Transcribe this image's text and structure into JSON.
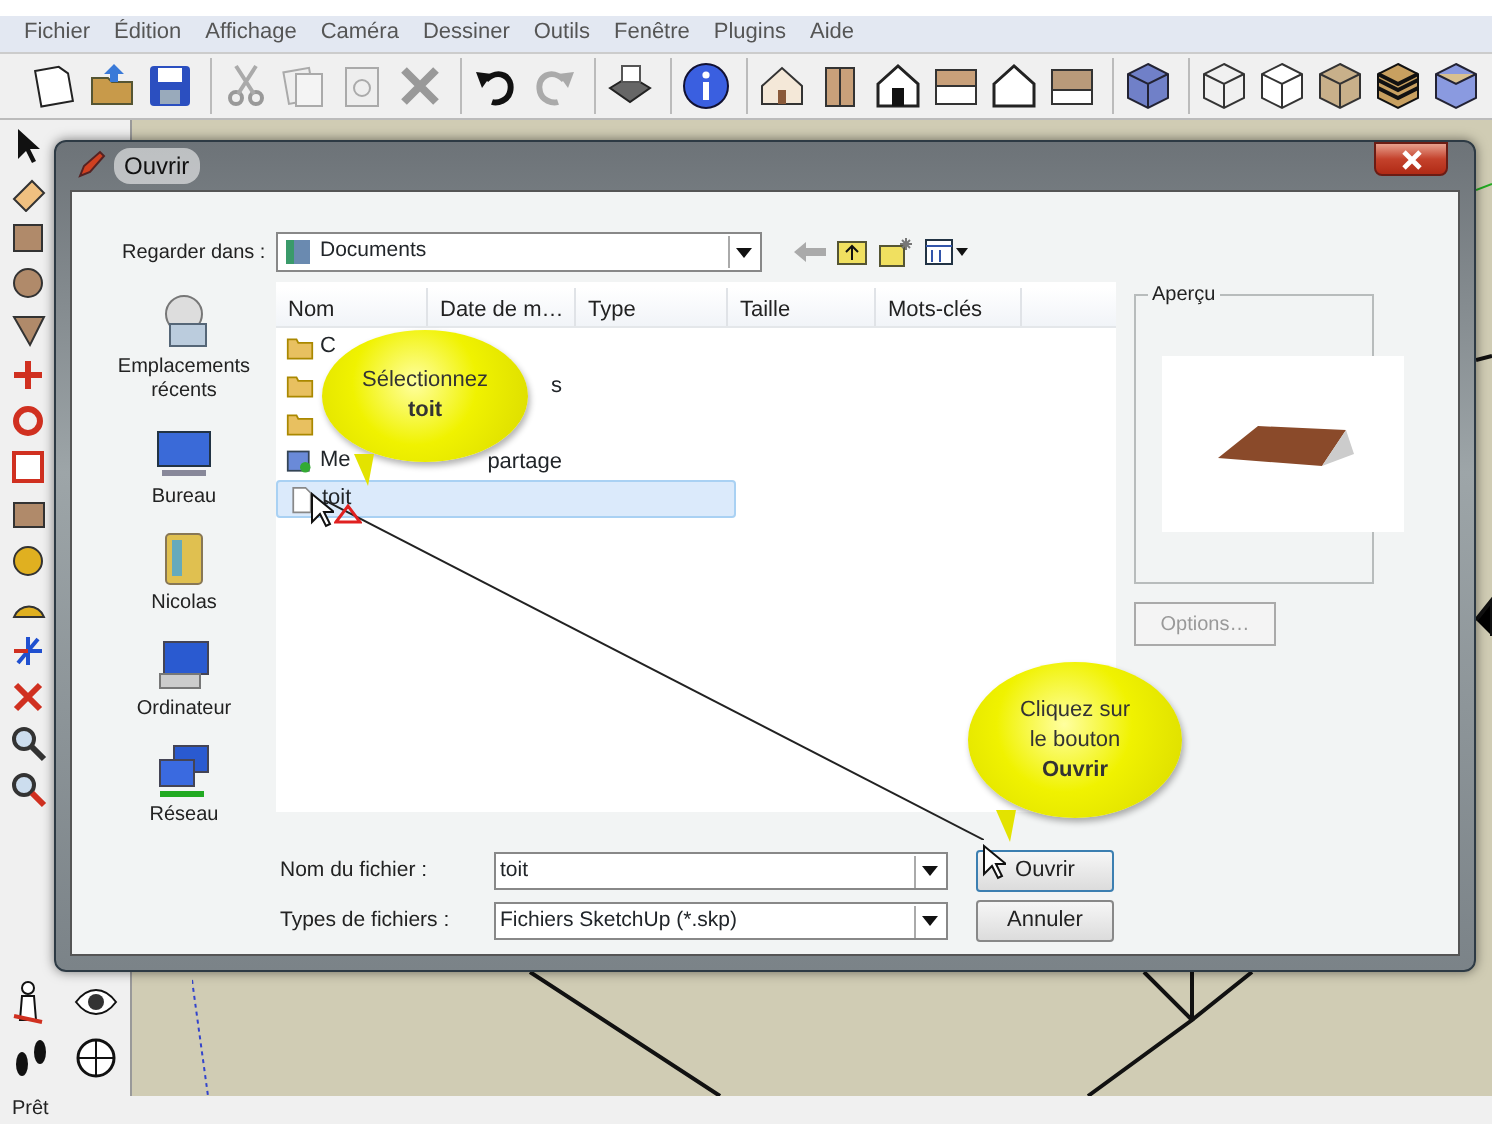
{
  "menu": [
    "Fichier",
    "Édition",
    "Affichage",
    "Caméra",
    "Dessiner",
    "Outils",
    "Fenêtre",
    "Plugins",
    "Aide"
  ],
  "dialog": {
    "title": "Ouvrir",
    "look_in_label": "Regarder dans :",
    "look_in_value": "Documents",
    "places": [
      "Emplacements récents",
      "Bureau",
      "Nicolas",
      "Ordinateur",
      "Réseau"
    ],
    "columns": [
      "Nom",
      "Date de m…",
      "Type",
      "Taille",
      "Mots-clés"
    ],
    "files": [
      {
        "kind": "folder",
        "name": "C",
        "selected": false
      },
      {
        "kind": "folder",
        "name_end": "s",
        "selected": false
      },
      {
        "kind": "folder",
        "selected": false
      },
      {
        "kind": "share",
        "name": "Me",
        "name_end": "partage",
        "selected": false
      },
      {
        "kind": "file",
        "name": "toit",
        "selected": true
      }
    ],
    "preview_label": "Aperçu",
    "options_button": {
      "label": "Options…",
      "disabled": true
    },
    "file_name_label": "Nom du fichier :",
    "file_name_value": "toit",
    "file_type_label": "Types de fichiers :",
    "file_type_value": "Fichiers SketchUp (*.skp)",
    "buttons": [
      "Ouvrir",
      "Annuler"
    ]
  },
  "callouts": [
    {
      "text": "Sélectionnez **toit**"
    },
    {
      "text": "Cliquez sur le bouton **Ouvrir**"
    }
  ],
  "status_bar": "Prêt"
}
